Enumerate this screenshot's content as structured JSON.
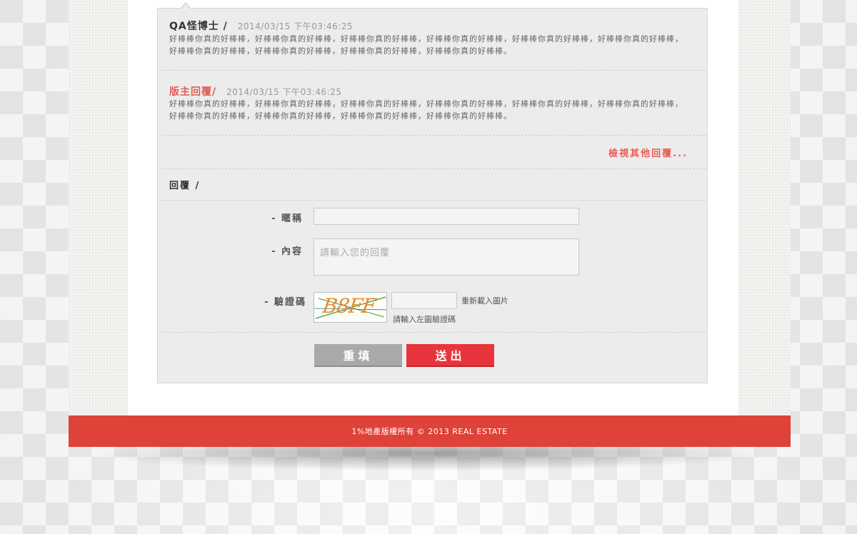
{
  "messages": [
    {
      "author": "QA怪博士 /",
      "time": "2014/03/15 下午03:46:25",
      "body_line1": "好棒棒你真的好棒棒，好棒棒你真的好棒棒，好棒棒你真的好棒棒，好棒棒你真的好棒棒，好棒棒你真的好棒棒，好棒棒你真的好棒棒，",
      "body_line2": "好棒棒你真的好棒棒，好棒棒你真的好棒棒，好棒棒你真的好棒棒，好棒棒你真的好棒棒。"
    },
    {
      "author": "版主回覆/",
      "time": "2014/03/15 下午03:46:25",
      "body_line1": "好棒棒你真的好棒棒，好棒棒你真的好棒棒，好棒棒你真的好棒棒，好棒棒你真的好棒棒，好棒棒你真的好棒棒，好棒棒你真的好棒棒，",
      "body_line2": "好棒棒你真的好棒棒，好棒棒你真的好棒棒，好棒棒你真的好棒棒，好棒棒你真的好棒棒。"
    }
  ],
  "more_link": "檢視其他回覆...",
  "reply_form": {
    "heading": "回覆 /",
    "nickname_label": "- 暱稱",
    "nickname_value": "",
    "content_label": "- 內容",
    "content_placeholder": "請輸入您的回覆",
    "captcha_label": "- 驗證碼",
    "captcha_image_text": "B8FF",
    "captcha_value": "",
    "captcha_refresh": "重新載入圖片",
    "captcha_hint": "請輸入左圖驗證碼",
    "reset_button": "重填",
    "submit_button": "送出"
  },
  "footer": {
    "copyright": "1%地產版權所有  © 2013 REAL ESTATE"
  },
  "colors": {
    "accent": "#e65c55",
    "submit": "#e8353c",
    "reset": "#a9a9a9",
    "footer": "#df4238"
  }
}
